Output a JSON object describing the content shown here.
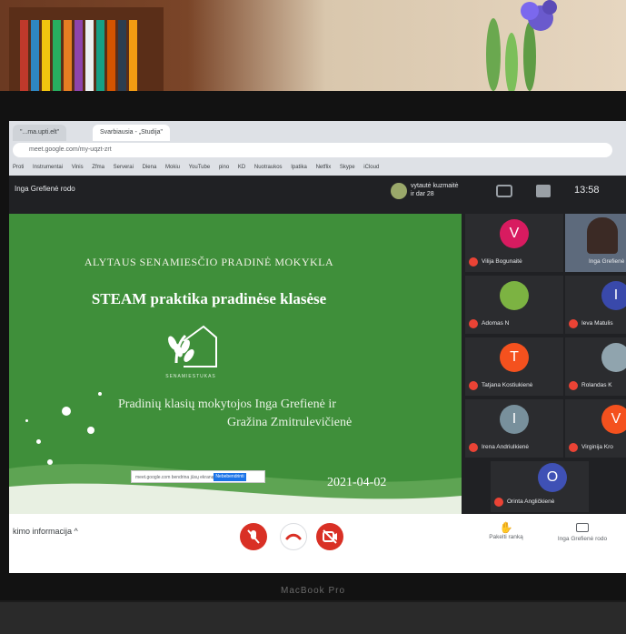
{
  "browser": {
    "tabs": [
      "\"...ma.upti.elt\"",
      "Svarbiausia - „Studija\""
    ],
    "url": "meet.google.com/my-uqzt-zrt",
    "bookmarks": [
      "Proti",
      "Instrumentai",
      "Vinis",
      "Zfma",
      "Serverai",
      "Diena",
      "Mokiu",
      "YouTube",
      "pino",
      "KD",
      "Nuotraukos",
      "Ipatika",
      "Netflix",
      "Skype",
      "iCloud"
    ]
  },
  "meet": {
    "presenting_label": "Inga Grefienė rodo",
    "notification": {
      "name": "vytautė kuzmaitė",
      "subtext": "ir dar 28"
    },
    "clock": "13:58",
    "participants": [
      {
        "initial": "V",
        "name": "Vilija Bogunaitė",
        "color": "#d81b60"
      },
      {
        "initial": "",
        "name": "Inga Grefienė",
        "color": "#5c6bc0"
      },
      {
        "initial": "",
        "name": "Adomas N",
        "color": "#7cb342"
      },
      {
        "initial": "I",
        "name": "Ieva Matulis",
        "color": "#3949ab"
      },
      {
        "initial": "T",
        "name": "Tatjana Kostiukienė",
        "color": "#f4511e"
      },
      {
        "initial": "",
        "name": "Rolandas K",
        "color": "#90a4ae"
      },
      {
        "initial": "I",
        "name": "Irena Andriulkienė",
        "color": "#78909c"
      },
      {
        "initial": "V",
        "name": "Virginija Kro",
        "color": "#f4511e"
      },
      {
        "initial": "O",
        "name": "Orinta Angličkienė",
        "color": "#3f51b5"
      }
    ],
    "bottom": {
      "meeting_info": "kimo informacija ^",
      "raise_hand": "Pakelti ranką",
      "presenting": "Inga Grefienė rodo"
    }
  },
  "slide": {
    "school": "ALYTAUS SENAMIESČIO PRADINĖ MOKYKLA",
    "title": "STEAM praktika pradinėse klasėse",
    "logo_text": "SENAMIESTUKAS",
    "authors_line1": "Pradinių klasių mokytojos Inga Grefienė ir",
    "authors_line2": "Gražina Zmitrulevičienė",
    "date": "2021-04-02",
    "share_bar_text": "meet.google.com bendrina jūsų ekraną",
    "share_bar_button": "Nebebendrinti"
  },
  "laptop": {
    "brand": "MacBook Pro"
  },
  "colors": {
    "slide_green": "#3f8f3a",
    "alert_red": "#d93025"
  }
}
